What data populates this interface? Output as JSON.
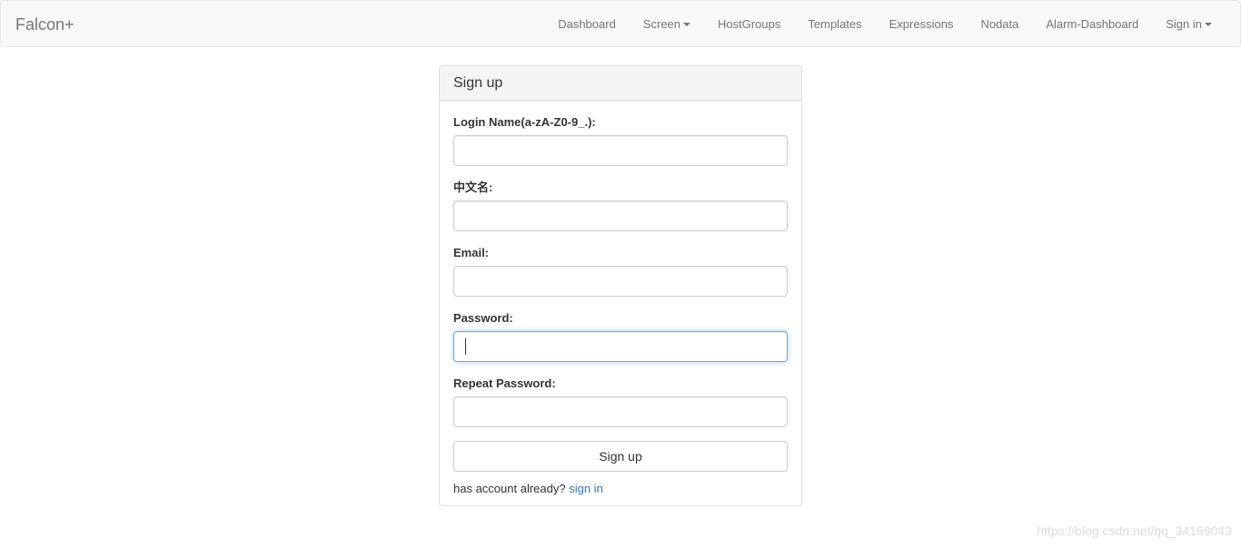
{
  "navbar": {
    "brand": "Falcon+",
    "items": [
      {
        "label": "Dashboard",
        "dropdown": false
      },
      {
        "label": "Screen",
        "dropdown": true
      },
      {
        "label": "HostGroups",
        "dropdown": false
      },
      {
        "label": "Templates",
        "dropdown": false
      },
      {
        "label": "Expressions",
        "dropdown": false
      },
      {
        "label": "Nodata",
        "dropdown": false
      },
      {
        "label": "Alarm-Dashboard",
        "dropdown": false
      },
      {
        "label": "Sign in",
        "dropdown": true
      }
    ]
  },
  "panel": {
    "title": "Sign up",
    "fields": [
      {
        "label": "Login Name(a-zA-Z0-9_.):",
        "value": ""
      },
      {
        "label": "中文名:",
        "value": ""
      },
      {
        "label": "Email:",
        "value": ""
      },
      {
        "label": "Password:",
        "value": "",
        "focused": true
      },
      {
        "label": "Repeat Password:",
        "value": ""
      }
    ],
    "submit_label": "Sign up",
    "footer_text": "has account already?",
    "footer_link": "sign in"
  },
  "watermark": "https://blog.csdn.net/qq_34169043",
  "colors": {
    "navbar_bg": "#f8f8f8",
    "link": "#337ab7",
    "focus_border": "#66afe9"
  }
}
